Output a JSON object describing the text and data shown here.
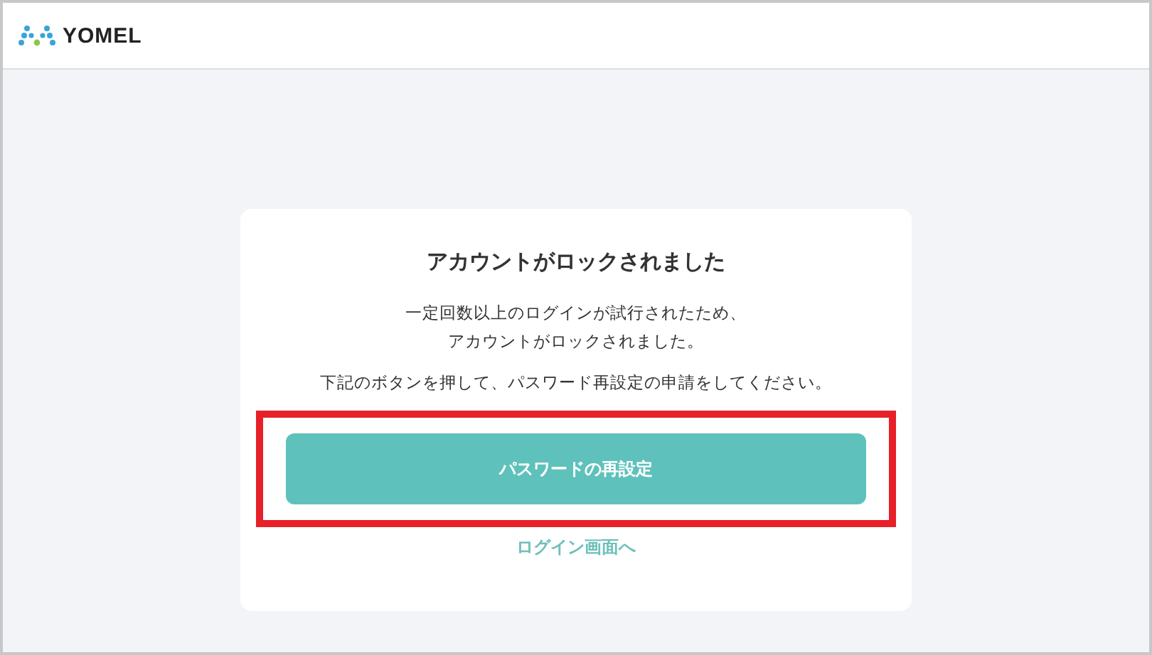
{
  "header": {
    "logo_text": "YOMEL"
  },
  "card": {
    "title": "アカウントがロックされました",
    "message_lines": [
      "一定回数以上のログインが試行されたため、",
      "アカウントがロックされました。"
    ],
    "instruction": "下記のボタンを押して、パスワード再設定の申請をしてください。",
    "button": {
      "label": "パスワードの再設定",
      "highlighted": true
    },
    "link": "ログイン画面へ"
  }
}
